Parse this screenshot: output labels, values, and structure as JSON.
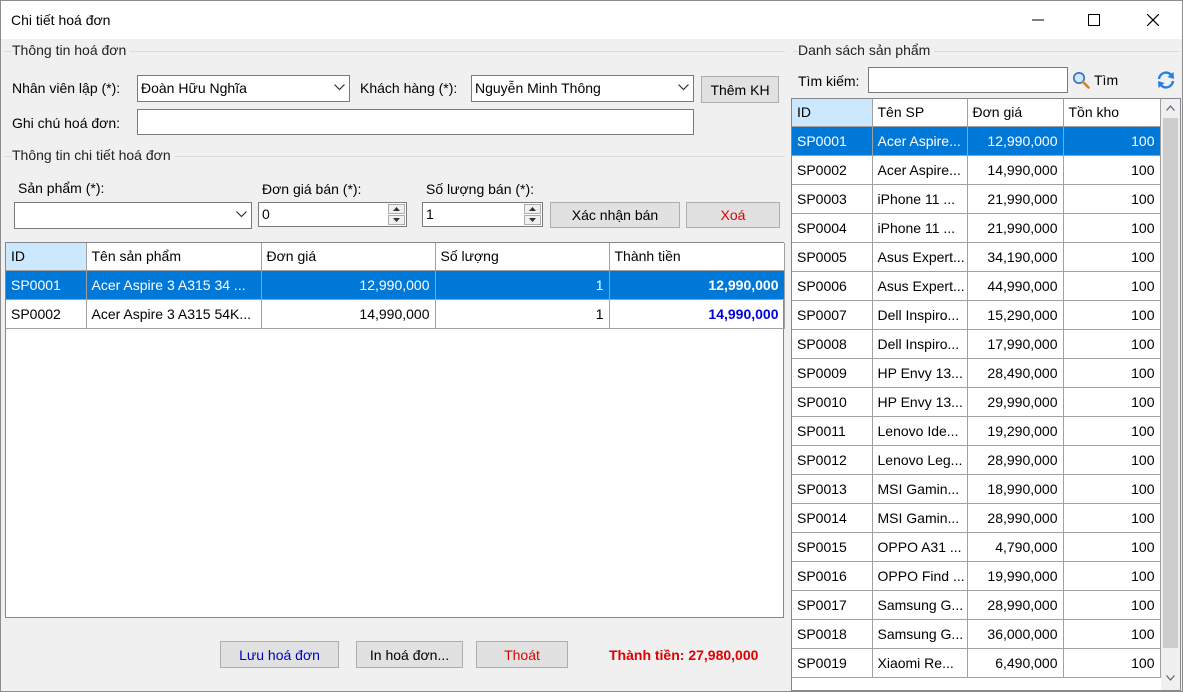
{
  "window": {
    "title": "Chi tiết hoá đơn"
  },
  "invoice_info": {
    "group_label": "Thông tin hoá đơn",
    "employee_label": "Nhân viên lập (*):",
    "employee_value": "Đoàn Hữu Nghĩa",
    "customer_label": "Khách hàng (*):",
    "customer_value": "Nguyễn Minh Thông",
    "add_customer_button": "Thêm KH",
    "note_label": "Ghi chú hoá đơn:",
    "note_value": ""
  },
  "detail_info": {
    "group_label": "Thông tin chi tiết hoá đơn",
    "product_label": "Sản phẩm (*):",
    "product_value": "",
    "price_label": "Đơn giá bán (*):",
    "price_value": "0",
    "qty_label": "Số lượng bán (*):",
    "qty_value": "1",
    "confirm_button": "Xác nhận bán",
    "delete_button": "Xoá"
  },
  "detail_grid": {
    "columns": [
      "ID",
      "Tên sản phẩm",
      "Đơn giá",
      "Số lượng",
      "Thành tiền"
    ],
    "rows": [
      {
        "id": "SP0001",
        "name": "Acer Aspire 3 A315 34 ...",
        "price": "12,990,000",
        "qty": "1",
        "total": "12,990,000"
      },
      {
        "id": "SP0002",
        "name": "Acer Aspire 3 A315 54K...",
        "price": "14,990,000",
        "qty": "1",
        "total": "14,990,000"
      }
    ]
  },
  "footer": {
    "save_button": "Lưu hoá đơn",
    "print_button": "In hoá đơn...",
    "exit_button": "Thoát",
    "total_text": "Thành tiền: 27,980,000"
  },
  "product_list": {
    "group_label": "Danh sách sản phẩm",
    "search_label": "Tìm kiếm:",
    "search_value": "",
    "search_button": "Tìm",
    "columns": [
      "ID",
      "Tên SP",
      "Đơn giá",
      "Tồn kho"
    ],
    "rows": [
      {
        "id": "SP0001",
        "name": "Acer Aspire...",
        "price": "12,990,000",
        "stock": "100"
      },
      {
        "id": "SP0002",
        "name": "Acer Aspire...",
        "price": "14,990,000",
        "stock": "100"
      },
      {
        "id": "SP0003",
        "name": "iPhone 11 ...",
        "price": "21,990,000",
        "stock": "100"
      },
      {
        "id": "SP0004",
        "name": "iPhone 11 ...",
        "price": "21,990,000",
        "stock": "100"
      },
      {
        "id": "SP0005",
        "name": "Asus Expert...",
        "price": "34,190,000",
        "stock": "100"
      },
      {
        "id": "SP0006",
        "name": "Asus Expert...",
        "price": "44,990,000",
        "stock": "100"
      },
      {
        "id": "SP0007",
        "name": "Dell Inspiro...",
        "price": "15,290,000",
        "stock": "100"
      },
      {
        "id": "SP0008",
        "name": "Dell Inspiro...",
        "price": "17,990,000",
        "stock": "100"
      },
      {
        "id": "SP0009",
        "name": "HP Envy 13...",
        "price": "28,490,000",
        "stock": "100"
      },
      {
        "id": "SP0010",
        "name": "HP Envy 13...",
        "price": "29,990,000",
        "stock": "100"
      },
      {
        "id": "SP0011",
        "name": "Lenovo Ide...",
        "price": "19,290,000",
        "stock": "100"
      },
      {
        "id": "SP0012",
        "name": "Lenovo Leg...",
        "price": "28,990,000",
        "stock": "100"
      },
      {
        "id": "SP0013",
        "name": "MSI Gamin...",
        "price": "18,990,000",
        "stock": "100"
      },
      {
        "id": "SP0014",
        "name": "MSI Gamin...",
        "price": "28,990,000",
        "stock": "100"
      },
      {
        "id": "SP0015",
        "name": "OPPO A31 ...",
        "price": "4,790,000",
        "stock": "100"
      },
      {
        "id": "SP0016",
        "name": "OPPO Find ...",
        "price": "19,990,000",
        "stock": "100"
      },
      {
        "id": "SP0017",
        "name": "Samsung G...",
        "price": "28,990,000",
        "stock": "100"
      },
      {
        "id": "SP0018",
        "name": "Samsung G...",
        "price": "36,000,000",
        "stock": "100"
      },
      {
        "id": "SP0019",
        "name": "Xiaomi Re...",
        "price": "6,490,000",
        "stock": "100"
      }
    ]
  },
  "colors": {
    "selection": "#0078d7",
    "header_selected": "#cce8ff",
    "total_red": "#e00000",
    "total_blue": "#0000e0"
  }
}
